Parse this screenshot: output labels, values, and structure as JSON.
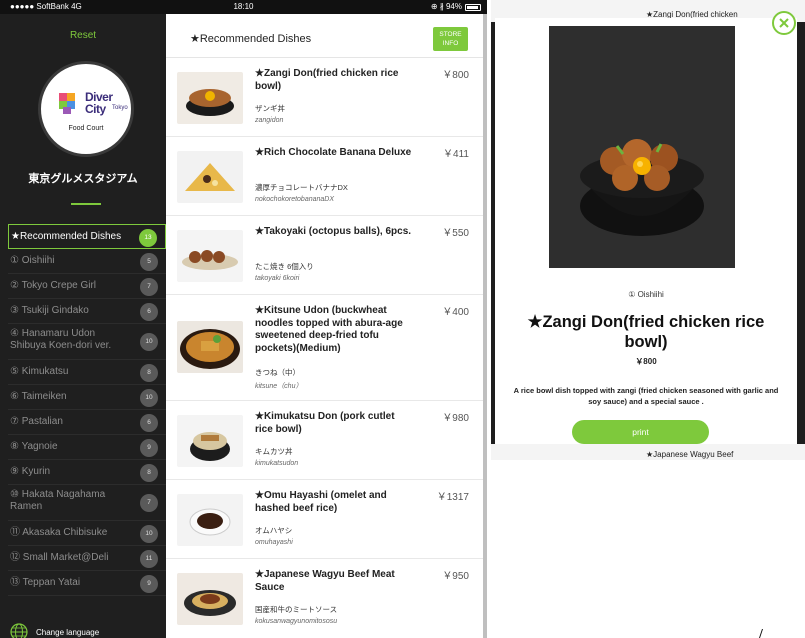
{
  "status_bar": {
    "carrier": "●●●●● SoftBank  4G",
    "time": "18:10",
    "battery": "⊕ ∦ 94%",
    "battery_level_percent": 94
  },
  "sidebar": {
    "reset_label": "Reset",
    "logo": {
      "word1": "Diver",
      "word2": "City",
      "word3": "Tokyo",
      "subtitle": "Food Court"
    },
    "venue_title": "東京グルメスタジアム",
    "shops": [
      {
        "label": "★Recommended Dishes",
        "count": "13",
        "active": true
      },
      {
        "label": "① Oishiihi",
        "count": "5"
      },
      {
        "label": "② Tokyo Crepe Girl",
        "count": "7"
      },
      {
        "label": "③ Tsukiji Gindako",
        "count": "6"
      },
      {
        "label": "④ Hanamaru Udon Shibuya Koen-dori ver.",
        "count": "10"
      },
      {
        "label": "⑤ Kimukatsu",
        "count": "8"
      },
      {
        "label": "⑥ Taimeiken",
        "count": "10"
      },
      {
        "label": "⑦ Pastalian",
        "count": "6"
      },
      {
        "label": "⑧ Yagnoie",
        "count": "9"
      },
      {
        "label": "⑨ Kyurin",
        "count": "8"
      },
      {
        "label": "⑩ Hakata Nagahama Ramen",
        "count": "7"
      },
      {
        "label": "⑪ Akasaka Chibisuke",
        "count": "10"
      },
      {
        "label": "⑫ Small Market@Deli",
        "count": "11"
      },
      {
        "label": "⑬ Teppan Yatai",
        "count": "9"
      }
    ],
    "change_language_label": "Change language"
  },
  "main": {
    "title": "★Recommended Dishes",
    "store_info_label": "STORE INFO",
    "dishes": [
      {
        "name": "★Zangi Don(fried chicken rice bowl)",
        "price": "￥800",
        "jp": "ザンギ丼",
        "romaji": "zangidon"
      },
      {
        "name": "★Rich Chocolate Banana Deluxe",
        "price": "￥411",
        "jp": "濃厚チョコレートバナナDX",
        "romaji": "nokochokoretobananaDX"
      },
      {
        "name": "★Takoyaki (octopus balls), 6pcs.",
        "price": "￥550",
        "jp": "たこ焼き 6個入り",
        "romaji": "takoyaki 6koiri"
      },
      {
        "name": "★Kitsune Udon (buckwheat noodles topped with abura-age sweetened deep-fried tofu pockets)(Medium)",
        "price": "￥400",
        "jp": "きつね（中）",
        "romaji": "kitsune（chu）"
      },
      {
        "name": "★Kimukatsu Don (pork cutlet rice bowl)",
        "price": "￥980",
        "jp": "キムカツ丼",
        "romaji": "kimukatsudon"
      },
      {
        "name": "★Omu Hayashi (omelet and hashed beef rice)",
        "price": "￥1317",
        "jp": "オムハヤシ",
        "romaji": "omuhayashi"
      },
      {
        "name": "★Japanese Wagyu Beef Meat Sauce",
        "price": "￥950",
        "jp": "国産和牛のミートソース",
        "romaji": "kokusanwagyunomitososu"
      }
    ]
  },
  "modal": {
    "background_top_text": "★Zangi Don(fried chicken",
    "background_bottom_text": "★Japanese Wagyu Beef",
    "shop": "① Oishiihi",
    "title": "★Zangi Don(fried chicken rice bowl)",
    "price": "￥800",
    "description": "A rice bowl dish topped with zangi (fried chicken seasoned with garlic and soy sauce) and a special sauce .",
    "print_label": "print"
  },
  "colors": {
    "accent": "#7ec93c",
    "sidebar_bg": "#1f1f1f"
  }
}
